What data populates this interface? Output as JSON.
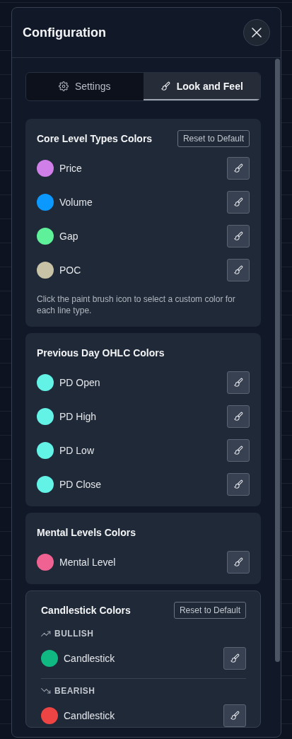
{
  "dialog": {
    "title": "Configuration"
  },
  "tabs": [
    {
      "label": "Settings",
      "selected": false
    },
    {
      "label": "Look and Feel",
      "selected": true
    }
  ],
  "sections": [
    {
      "kind": "list",
      "title": "Core Level Types Colors",
      "reset_button": "Reset to Default",
      "items": [
        {
          "label": "Price",
          "color": "#d17fe8"
        },
        {
          "label": "Volume",
          "color": "#0b99ff"
        },
        {
          "label": "Gap",
          "color": "#5ff09a"
        },
        {
          "label": "POC",
          "color": "#c8c3a6"
        }
      ],
      "note": "Click the paint brush icon to select a custom color for each line type."
    },
    {
      "kind": "list",
      "title": "Previous Day OHLC Colors",
      "items": [
        {
          "label": "PD Open",
          "color": "#62f3e6"
        },
        {
          "label": "PD High",
          "color": "#62f3e6"
        },
        {
          "label": "PD Low",
          "color": "#62f3e6"
        },
        {
          "label": "PD Close",
          "color": "#62f3e6"
        }
      ]
    },
    {
      "kind": "list",
      "title": "Mental Levels Colors",
      "items": [
        {
          "label": "Mental Level",
          "color": "#f06292"
        }
      ]
    },
    {
      "kind": "grouped",
      "title": "Candlestick Colors",
      "reset_button": "Reset to Default",
      "groups": [
        {
          "heading": "BULLISH",
          "items": [
            {
              "label": "Candlestick",
              "color": "#10b981"
            }
          ]
        },
        {
          "heading": "BEARISH",
          "items": [
            {
              "label": "Candlestick",
              "color": "#ef4444"
            }
          ]
        }
      ]
    }
  ]
}
